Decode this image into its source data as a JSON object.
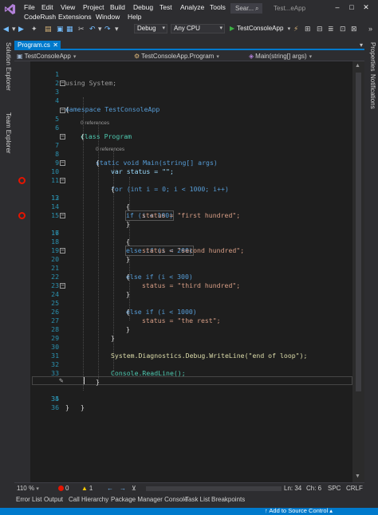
{
  "menu": {
    "items": [
      "File",
      "Edit",
      "View",
      "Project",
      "Build",
      "Debug",
      "Test",
      "Analyze",
      "Tools",
      "CodeRush",
      "Extensions",
      "Window",
      "Help"
    ],
    "search_placeholder": "Sear...",
    "window_title": "Test...eApp"
  },
  "toolbar": {
    "configuration": "Debug",
    "platform": "Any CPU",
    "run_target": "TestConsoleApp"
  },
  "left_strip": {
    "items": [
      "Solution Explorer",
      "Team Explorer"
    ]
  },
  "right_strip": {
    "items": [
      "Properties",
      "Notifications"
    ]
  },
  "document_tabs": {
    "active_tab": "Program.cs"
  },
  "navbar": {
    "project": "TestConsoleApp",
    "type": "TestConsoleApp.Program",
    "member": "Main(string[] args)"
  },
  "editor": {
    "lines": [
      {
        "n": "1",
        "text": "using System;"
      },
      {
        "n": "2",
        "text": ""
      },
      {
        "n": "3",
        "text": "namespace TestConsoleApp"
      },
      {
        "n": "4",
        "text": "{"
      },
      {
        "n": "5",
        "text": "class Program"
      },
      {
        "n": "6",
        "text": "{"
      },
      {
        "n": "7",
        "text": "static void Main(string[] args)"
      },
      {
        "n": "8",
        "text": "{"
      },
      {
        "n": "9",
        "text": "var status = \"\";"
      },
      {
        "n": "10",
        "text": "for (int i = 0; i < 1000; i++)"
      },
      {
        "n": "11",
        "text": "{"
      },
      {
        "n": "12",
        "text": "if (i < 100)"
      },
      {
        "n": "13",
        "text": "{"
      },
      {
        "n": "14",
        "text": "status = \"first hundred\";"
      },
      {
        "n": "15",
        "text": "}"
      },
      {
        "n": "16",
        "text": "else if (i < 200)"
      },
      {
        "n": "17",
        "text": "{"
      },
      {
        "n": "18",
        "text": "status = \"second hundred\";"
      },
      {
        "n": "19",
        "text": "}"
      },
      {
        "n": "20",
        "text": "else if (i < 300)"
      },
      {
        "n": "21",
        "text": "{"
      },
      {
        "n": "22",
        "text": "status = \"third hundred\";"
      },
      {
        "n": "23",
        "text": "}"
      },
      {
        "n": "24",
        "text": "else if (i < 1000)"
      },
      {
        "n": "25",
        "text": "{"
      },
      {
        "n": "26",
        "text": "status = \"the rest\";"
      },
      {
        "n": "27",
        "text": "}"
      },
      {
        "n": "28",
        "text": "}"
      },
      {
        "n": "29",
        "text": ""
      },
      {
        "n": "30",
        "text": "System.Diagnostics.Debug.WriteLine(\"end of loop\");"
      },
      {
        "n": "31",
        "text": ""
      },
      {
        "n": "32",
        "text": "Console.ReadLine();"
      },
      {
        "n": "33",
        "text": "}"
      },
      {
        "n": "34",
        "text": "}"
      },
      {
        "n": "35",
        "text": "}"
      },
      {
        "n": "36",
        "text": ""
      }
    ],
    "codelens": [
      "0 references",
      "0 references"
    ],
    "breakpoint_lines": [
      "12",
      "16"
    ]
  },
  "editor_status": {
    "zoom": "110 %",
    "errors": "0",
    "warnings": "1",
    "line": "Ln: 34",
    "col": "Ch: 6",
    "whitespace": "SPC",
    "line_ending": "CRLF"
  },
  "bottom_tabs": [
    "Error List",
    "Output",
    "Call Hierarchy",
    "Package Manager Console",
    "Task List",
    "Breakpoints"
  ],
  "status_bar": {
    "message": "Add to Source Control"
  },
  "colors": {
    "accent": "#007acc",
    "editor_bg": "#1e1e1e",
    "chrome_bg": "#2d2d30",
    "keyword": "#569cd6",
    "type": "#4ec9b0",
    "string": "#d69d85",
    "number": "#b5cea8",
    "line_number": "#2b91af",
    "breakpoint": "#e51400"
  }
}
